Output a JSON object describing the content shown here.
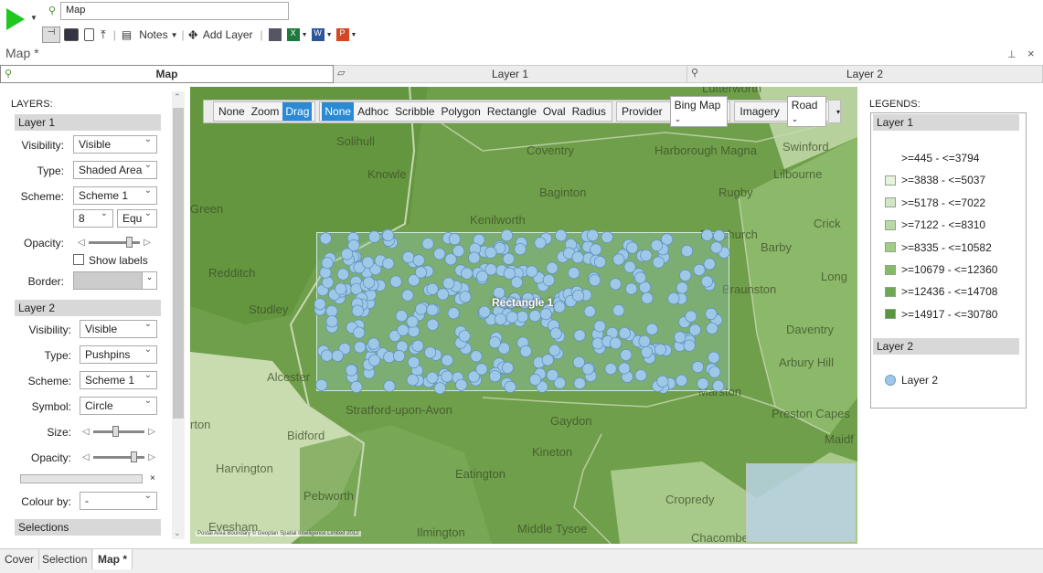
{
  "window": {
    "title_value": "Map",
    "page_title": "Map *"
  },
  "toolbar": {
    "notes_label": "Notes",
    "add_layer_label": "Add Layer"
  },
  "tabs": [
    {
      "label": "Map"
    },
    {
      "label": "Layer 1"
    },
    {
      "label": "Layer 2"
    }
  ],
  "layers_panel": {
    "heading": "LAYERS:",
    "layer1": {
      "title": "Layer 1",
      "visibility_label": "Visibility:",
      "visibility_value": "Visible",
      "type_label": "Type:",
      "type_value": "Shaded Area",
      "scheme_label": "Scheme:",
      "scheme_value": "Scheme 1",
      "classes_value": "8",
      "classes_method": "Equ",
      "opacity_label": "Opacity:",
      "opacity_level": 0.8,
      "show_labels_label": "Show labels",
      "show_labels_checked": false,
      "border_label": "Border:"
    },
    "layer2": {
      "title": "Layer 2",
      "visibility_label": "Visibility:",
      "visibility_value": "Visible",
      "type_label": "Type:",
      "type_value": "Pushpins",
      "scheme_label": "Scheme:",
      "scheme_value": "Scheme 1",
      "symbol_label": "Symbol:",
      "symbol_value": "Circle",
      "size_label": "Size:",
      "size_level": 0.45,
      "opacity_label": "Opacity:",
      "opacity_level": 0.8,
      "colour_by_label": "Colour by:",
      "colour_by_value": "-"
    },
    "selections_label": "Selections"
  },
  "map_toolbar": {
    "nav": [
      {
        "label": "None"
      },
      {
        "label": "Zoom"
      },
      {
        "label": "Drag",
        "active": true
      }
    ],
    "select": [
      {
        "label": "None",
        "active": true
      },
      {
        "label": "Adhoc"
      },
      {
        "label": "Scribble"
      },
      {
        "label": "Polygon"
      },
      {
        "label": "Rectangle"
      },
      {
        "label": "Oval"
      },
      {
        "label": "Radius"
      }
    ],
    "provider_label": "Provider",
    "provider_value": "Bing Map",
    "imagery_label": "Imagery",
    "imagery_value": "Road"
  },
  "map": {
    "selection_label": "Rectangle 1",
    "attribution": "Postal Area Boundary © Geoplan Spatial Intelligence Limited 2012",
    "places": [
      "Lutterworth",
      "Solihull",
      "Coventry",
      "Harborough Magna",
      "Swinford",
      "Knowle",
      "Lilbourne",
      "Baginton",
      "Rugby",
      "Green",
      "Kenilworth",
      "Crick",
      "Dunchurch",
      "Barby",
      "Redditch",
      "Long",
      "Studley",
      "Braunston",
      "Daventry",
      "Alcester",
      "Arbury Hill",
      "Marston",
      "Stratford-upon-Avon",
      "Gaydon",
      "Preston Capes",
      "rton",
      "Bidford",
      "Maidf",
      "Kineton",
      "Harvington",
      "Eatington",
      "Pebworth",
      "Cropredy",
      "Evesham",
      "Ilmington",
      "Middle Tysoe",
      "Chacombe"
    ]
  },
  "legend": {
    "heading": "LEGENDS:",
    "layer1_title": "Layer 1",
    "ranges": [
      {
        "label": ">=445 - <=3794",
        "color": "#ffffff"
      },
      {
        "label": ">=3838 - <=5037",
        "color": "#e8f2e1"
      },
      {
        "label": ">=5178 - <=7022",
        "color": "#d2e6c5"
      },
      {
        "label": ">=7122 - <=8310",
        "color": "#bbd9a7"
      },
      {
        "label": ">=8335 - <=10582",
        "color": "#a2cb88"
      },
      {
        "label": ">=10679 - <=12360",
        "color": "#86ba68"
      },
      {
        "label": ">=12436 - <=14708",
        "color": "#6ea852"
      },
      {
        "label": ">=14917 - <=30780",
        "color": "#5a9540"
      }
    ],
    "layer2_title": "Layer 2",
    "layer2_item": "Layer 2"
  },
  "bottom_tabs": [
    {
      "label": "Cover"
    },
    {
      "label": "Selection"
    },
    {
      "label": "Map *",
      "active": true
    }
  ],
  "colors": {
    "accent": "#2a8ad4",
    "pushpin": "#9fc8e8",
    "map_base": "#6f9f4a"
  }
}
